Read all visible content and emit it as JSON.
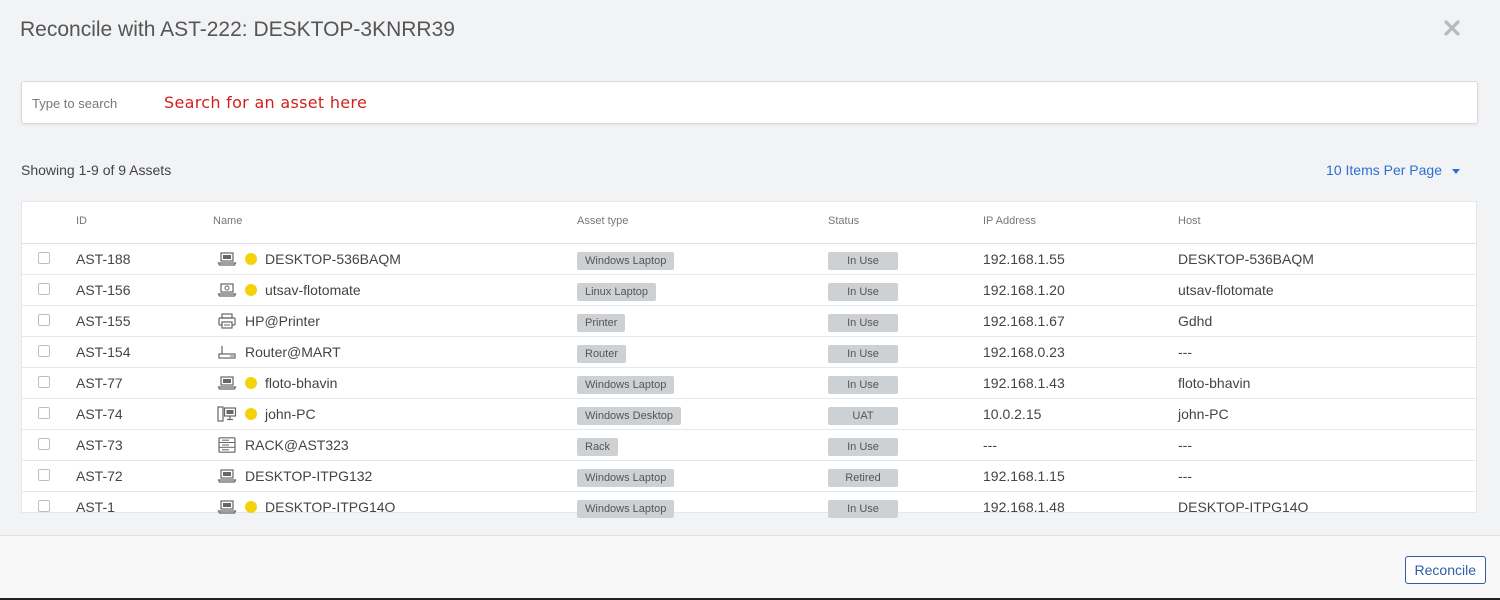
{
  "modal": {
    "title": "Reconcile with AST-222: DESKTOP-3KNRR39",
    "close_icon": "close-icon"
  },
  "search": {
    "placeholder": "Type to search",
    "value": "",
    "hint": "Search for an asset here"
  },
  "summary": {
    "showing": "Showing 1-9 of 9 Assets",
    "per_page": "10 Items Per Page"
  },
  "table": {
    "columns": [
      "ID",
      "Name",
      "Asset type",
      "Status",
      "IP Address",
      "Host"
    ],
    "rows": [
      {
        "id": "AST-188",
        "icon": "laptop-icon",
        "dot": true,
        "name": "DESKTOP-536BAQM",
        "type": "Windows Laptop",
        "status": "In Use",
        "ip": "192.168.1.55",
        "host": "DESKTOP-536BAQM"
      },
      {
        "id": "AST-156",
        "icon": "linux-laptop-icon",
        "dot": true,
        "name": "utsav-flotomate",
        "type": "Linux Laptop",
        "status": "In Use",
        "ip": "192.168.1.20",
        "host": "utsav-flotomate"
      },
      {
        "id": "AST-155",
        "icon": "printer-icon",
        "dot": false,
        "name": "HP@Printer",
        "type": "Printer",
        "status": "In Use",
        "ip": "192.168.1.67",
        "host": "Gdhd"
      },
      {
        "id": "AST-154",
        "icon": "router-icon",
        "dot": false,
        "name": "Router@MART",
        "type": "Router",
        "status": "In Use",
        "ip": "192.168.0.23",
        "host": "---"
      },
      {
        "id": "AST-77",
        "icon": "laptop-icon",
        "dot": true,
        "name": "floto-bhavin",
        "type": "Windows Laptop",
        "status": "In Use",
        "ip": "192.168.1.43",
        "host": "floto-bhavin"
      },
      {
        "id": "AST-74",
        "icon": "desktop-icon",
        "dot": true,
        "name": "john-PC",
        "type": "Windows Desktop",
        "status": "UAT",
        "ip": "10.0.2.15",
        "host": "john-PC"
      },
      {
        "id": "AST-73",
        "icon": "rack-icon",
        "dot": false,
        "name": "RACK@AST323",
        "type": "Rack",
        "status": "In Use",
        "ip": "---",
        "host": "---"
      },
      {
        "id": "AST-72",
        "icon": "laptop-icon",
        "dot": false,
        "name": "DESKTOP-ITPG132",
        "type": "Windows Laptop",
        "status": "Retired",
        "ip": "192.168.1.15",
        "host": "---"
      },
      {
        "id": "AST-1",
        "icon": "laptop-icon",
        "dot": true,
        "name": "DESKTOP-ITPG14O",
        "type": "Windows Laptop",
        "status": "In Use",
        "ip": "192.168.1.48",
        "host": "DESKTOP-ITPG14O"
      }
    ]
  },
  "footer": {
    "reconcile_label": "Reconcile"
  },
  "colors": {
    "accent": "#2f6fd0",
    "hint": "#d21f1f",
    "online_dot": "#f4d20a",
    "badge": "#ced1d4"
  }
}
